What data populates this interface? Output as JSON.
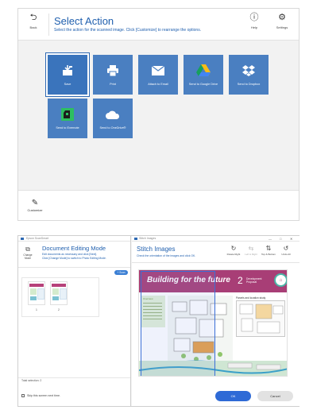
{
  "select_action": {
    "back_label": "Back",
    "title": "Select Action",
    "subtitle": "Select the action for the scanned image. Click [Customize] to rearrange the options.",
    "help_label": "Help",
    "settings_label": "Settings",
    "tiles": [
      {
        "label": "Save",
        "icon": "save-icon",
        "selected": true
      },
      {
        "label": "Print",
        "icon": "printer-icon"
      },
      {
        "label": "Attach to Email",
        "icon": "envelope-icon"
      },
      {
        "label": "Send to Google Drive",
        "icon": "google-drive-icon"
      },
      {
        "label": "Send to Dropbox",
        "icon": "dropbox-icon"
      },
      {
        "label": "Send to Evernote",
        "icon": "evernote-icon"
      },
      {
        "label": "Send to OneDrive®",
        "icon": "onedrive-icon"
      }
    ],
    "customize_label": "Customize",
    "colors": {
      "tile": "#4a7fc1",
      "title": "#1f5fae"
    }
  },
  "document_editing": {
    "window_title": "Epson ScanSmart",
    "change_mode_label": "Change Mode",
    "title": "Document Editing Mode",
    "desc_line1": "Edit documents as necessary and click [Next].",
    "desc_line2": "Click [Change Mode] to switch to Photo Editing Mode.",
    "scan_label": "+ Scan",
    "thumbnails": [
      {
        "number": "1"
      },
      {
        "number": "2"
      }
    ],
    "total_label": "Total selection: 2",
    "skip_label": "Skip this screen next time."
  },
  "stitch_images": {
    "window_title": "Stitch Images",
    "title": "Stitch Images",
    "description": "Check the orientation of the images and click OK.",
    "tools": [
      {
        "label": "Rotate Right",
        "icon": "rotate-right-icon"
      },
      {
        "label": "Left & Right",
        "icon": "left-right-icon"
      },
      {
        "label": "Top & Bottom",
        "icon": "top-bottom-icon"
      },
      {
        "label": "Undo All",
        "icon": "undo-icon"
      }
    ],
    "document": {
      "heading": "Building for the future",
      "number": "2",
      "side_line1": "Development",
      "side_line2": "Proposal",
      "left_heading": "Overview",
      "right_heading": "Parcels and location study"
    },
    "ok_label": "OK",
    "cancel_label": "Cancel",
    "colors": {
      "band": "#a83e76",
      "ok": "#2e6ad6"
    }
  }
}
